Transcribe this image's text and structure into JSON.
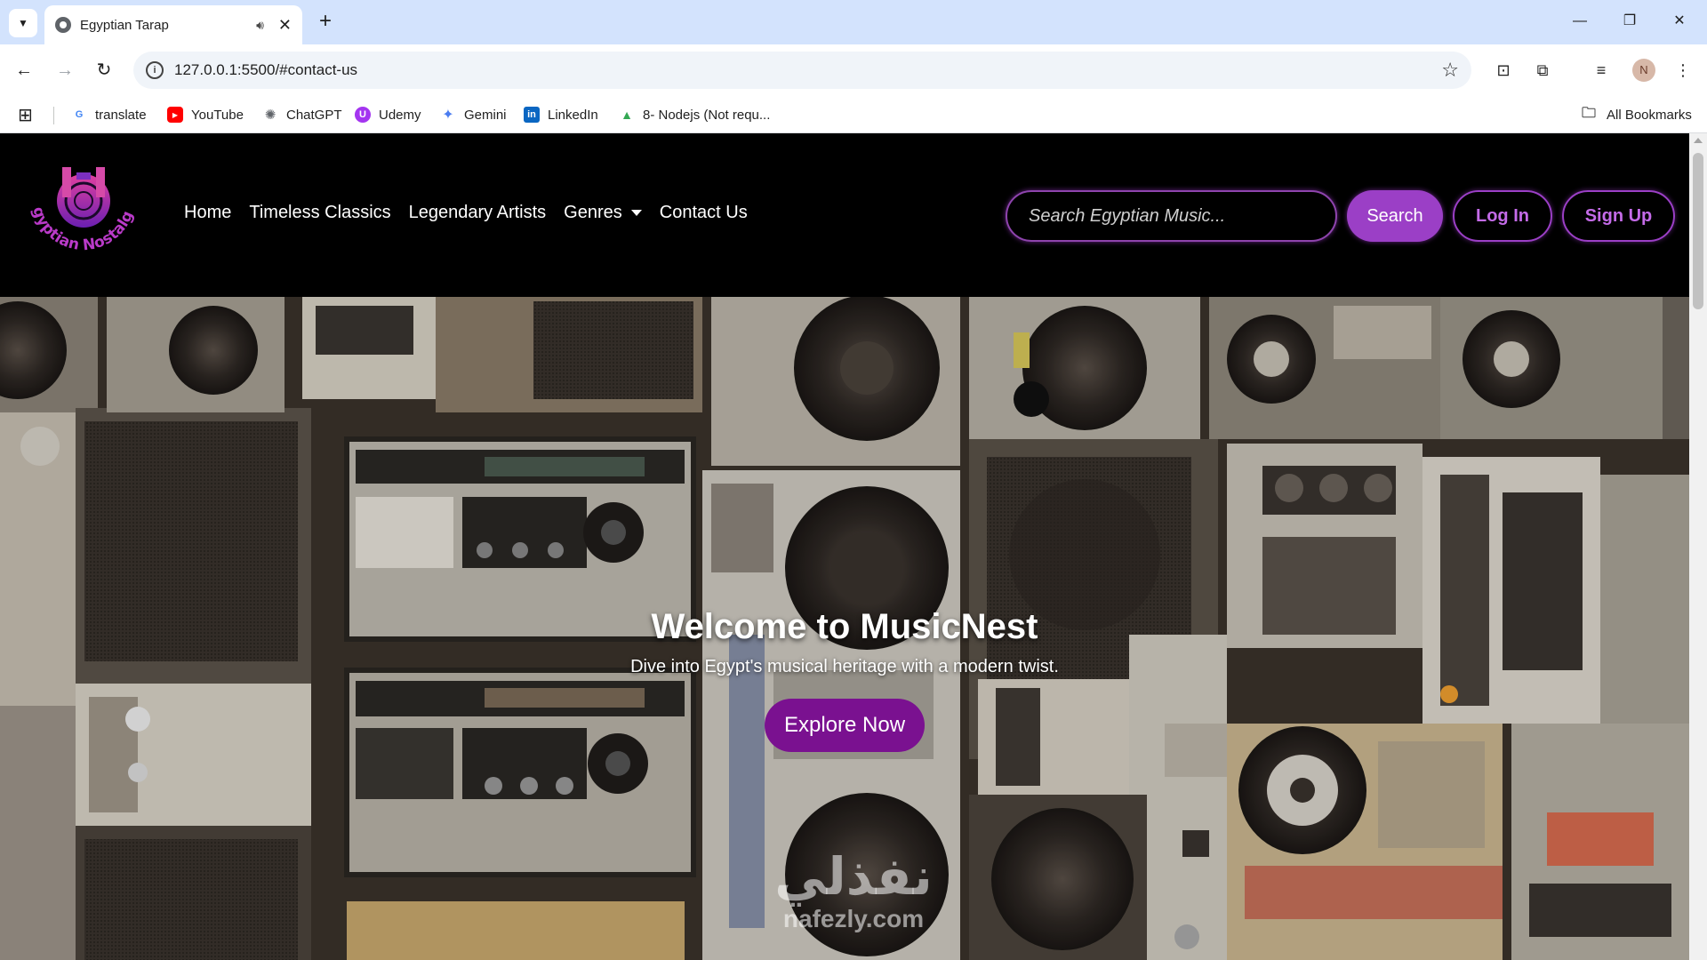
{
  "browser": {
    "tab_title": "Egyptian Tarap",
    "url": "127.0.0.1:5500/#contact-us",
    "profile_initial": "N",
    "bookmarks": [
      {
        "label": "translate",
        "icon": "google-translate-icon",
        "color": "#4285f4",
        "glyph": "G"
      },
      {
        "label": "YouTube",
        "icon": "youtube-icon",
        "color": "#ff0000",
        "glyph": "▶"
      },
      {
        "label": "ChatGPT",
        "icon": "chatgpt-icon",
        "color": "#5f6368",
        "glyph": "✺"
      },
      {
        "label": "Udemy",
        "icon": "udemy-icon",
        "color": "#a435f0",
        "glyph": "U"
      },
      {
        "label": "Gemini",
        "icon": "gemini-icon",
        "color": "#4a7cf0",
        "glyph": "✦"
      },
      {
        "label": "LinkedIn",
        "icon": "linkedin-icon",
        "color": "#0a66c2",
        "glyph": "in"
      },
      {
        "label": "8- Nodejs (Not requ...",
        "icon": "google-drive-icon",
        "color": "#34a853",
        "glyph": "▲"
      }
    ],
    "all_bookmarks": "All Bookmarks"
  },
  "site": {
    "logo_text": "Egyptian Nostalgia",
    "nav": {
      "home": "Home",
      "classics": "Timeless Classics",
      "artists": "Legendary Artists",
      "genres": "Genres",
      "contact": "Contact Us"
    },
    "search_placeholder": "Search Egyptian Music...",
    "search_button": "Search",
    "login": "Log In",
    "signup": "Sign Up",
    "accent_color": "#9b3fc6"
  },
  "hero": {
    "title": "Welcome to MusicNest",
    "subtitle": "Dive into Egypt's musical heritage with a modern twist.",
    "cta": "Explore Now",
    "watermark_ar": "نفذلي",
    "watermark_en": "nafezly.com"
  }
}
